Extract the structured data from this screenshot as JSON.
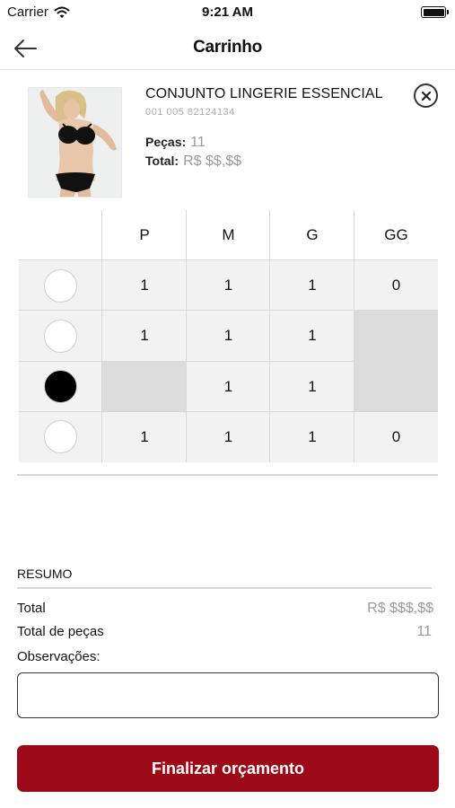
{
  "status_bar": {
    "carrier": "Carrier",
    "time": "9:21 AM"
  },
  "nav": {
    "title": "Carrinho"
  },
  "product": {
    "name": "CONJUNTO LINGERIE ESSENCIAL",
    "code": "001 005 82124134",
    "pieces_label": "Peças:",
    "pieces_value": "11",
    "total_label": "Total:",
    "total_value": "R$ $$,$$"
  },
  "grid": {
    "sizes": [
      "P",
      "M",
      "G",
      "GG"
    ],
    "rows": [
      {
        "swatch": "#ffffff",
        "cells": [
          "1",
          "1",
          "1",
          "0"
        ]
      },
      {
        "swatch": "#ffffff",
        "cells": [
          "1",
          "1",
          "1",
          null
        ]
      },
      {
        "swatch": "#000000",
        "cells": [
          null,
          "1",
          "1",
          null
        ]
      },
      {
        "swatch": "#ffffff",
        "cells": [
          "1",
          "1",
          "1",
          "0"
        ]
      }
    ]
  },
  "summary": {
    "title": "RESUMO",
    "total_label": "Total",
    "total_value": "R$ $$$,$$",
    "pieces_label": "Total de peças",
    "pieces_value": "11",
    "notes_label": "Observações:",
    "notes_value": ""
  },
  "finalize_button": "Finalizar orçamento",
  "colors": {
    "accent": "#9b0a16",
    "cell_bg": "#f2f2f2",
    "disabled_bg": "#dcdcdc",
    "border": "#d9d9d9"
  }
}
